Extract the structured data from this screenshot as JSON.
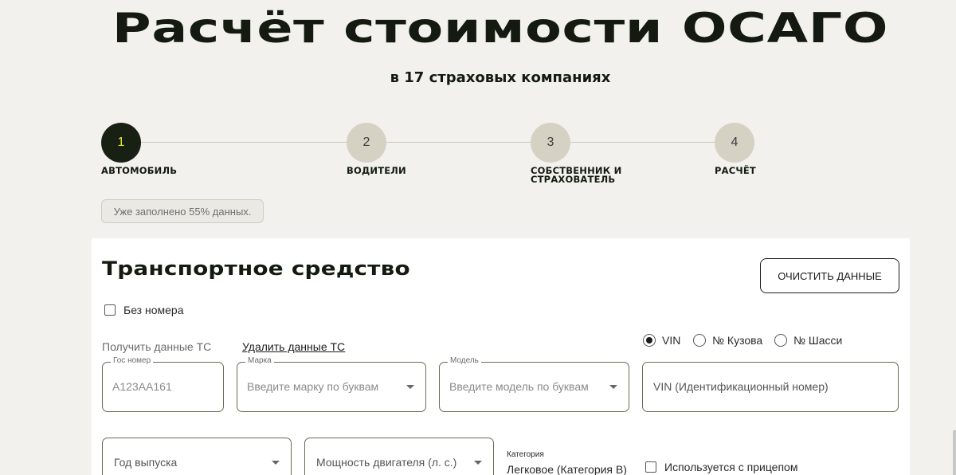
{
  "header": {
    "title": "Расчёт стоимости ОСАГО",
    "subtitle": "в 17 страховых компаниях"
  },
  "steps": [
    {
      "number": "1",
      "label": "АВТОМОБИЛЬ",
      "active": true
    },
    {
      "number": "2",
      "label": "ВОДИТЕЛИ",
      "active": false
    },
    {
      "number": "3",
      "label_line1": "СОБСТВЕННИК И",
      "label_line2": "СТРАХОВАТЕЛЬ",
      "active": false
    },
    {
      "number": "4",
      "label": "РАСЧЁТ",
      "active": false
    }
  ],
  "progress_text": "Уже заполнено 55% данных.",
  "form": {
    "section_title": "Транспортное средство",
    "clear_button": "ОЧИСТИТЬ ДАННЫЕ",
    "no_plate_label": "Без номера",
    "get_data_label": "Получить данные ТС",
    "delete_data_link": "Удалить данные ТС",
    "id_type": {
      "options": [
        "VIN",
        "№ Кузова",
        "№ Шасси"
      ],
      "selected": "VIN"
    },
    "plate": {
      "legend": "Гос номер",
      "placeholder": "А123АА161"
    },
    "brand": {
      "legend": "Марка",
      "placeholder": "Введите марку по буквам"
    },
    "model": {
      "legend": "Модель",
      "placeholder": "Введите модель по буквам"
    },
    "vin": {
      "placeholder": "VIN (Идентификационный номер)"
    },
    "year": {
      "placeholder": "Год выпуска"
    },
    "power": {
      "placeholder": "Мощность двигателя (л. с.)"
    },
    "category": {
      "label": "Категория",
      "value": "Легковое (Категория B)"
    },
    "trailer_label": "Используется с прицепом"
  },
  "colors": {
    "background": "#f2f1ee",
    "accent_dark": "#172013",
    "accent_yellow": "#e4e93a",
    "step_inactive": "#d5d2c4",
    "field_border": "#6b6a56"
  }
}
